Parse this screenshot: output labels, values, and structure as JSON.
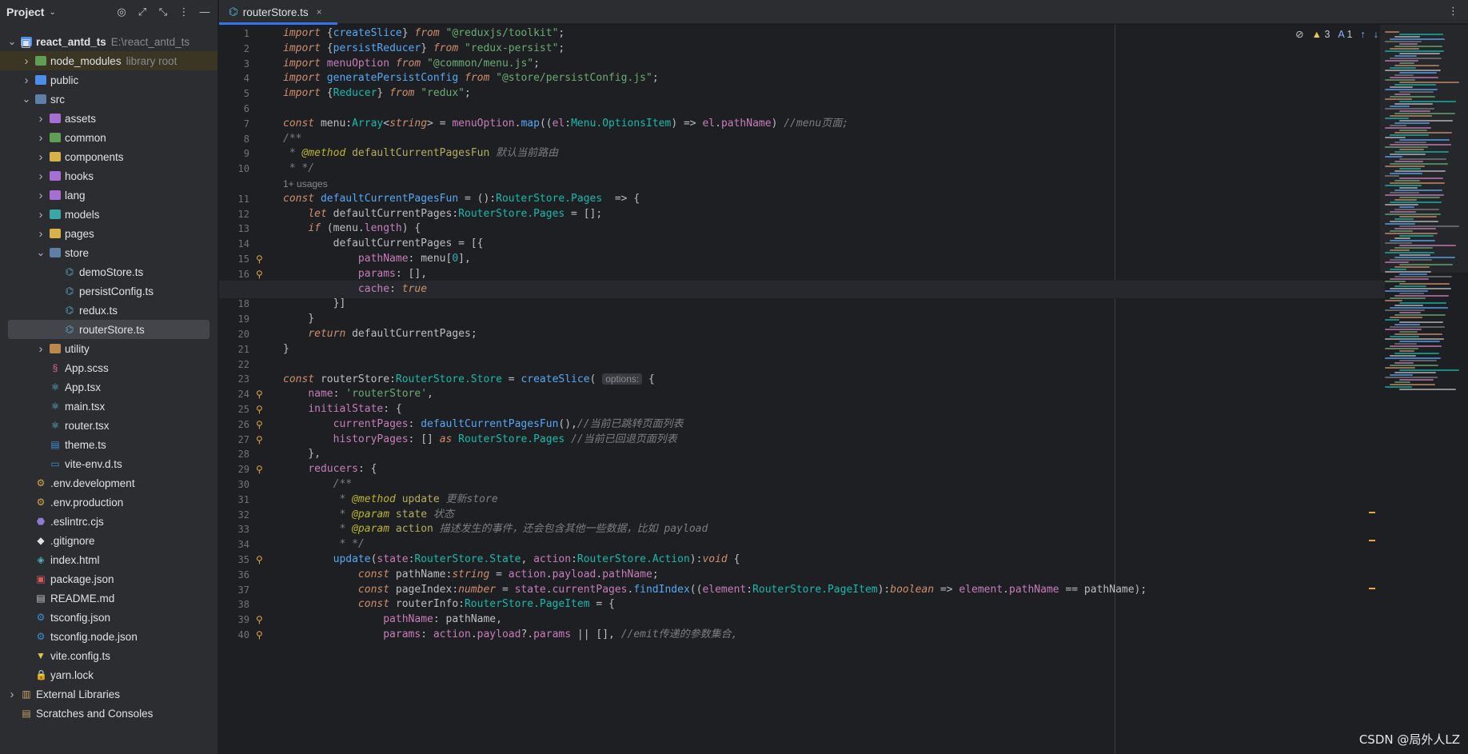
{
  "sidebar": {
    "title": "Project",
    "header_icons": [
      "target-icon",
      "expand-icon",
      "collapse-icon",
      "more-icon",
      "minimize-icon"
    ],
    "tree": [
      {
        "label": "react_antd_ts",
        "secondary": "E:\\react_antd_ts",
        "indent": 0,
        "arrow": "down",
        "icon": "folder-module",
        "bold": true
      },
      {
        "label": "node_modules",
        "secondary": "library root",
        "indent": 1,
        "arrow": "right",
        "icon": "folder-lib",
        "hl": "lib"
      },
      {
        "label": "public",
        "indent": 1,
        "arrow": "right",
        "icon": "folder-blue"
      },
      {
        "label": "src",
        "indent": 1,
        "arrow": "down",
        "icon": "folder-src"
      },
      {
        "label": "assets",
        "indent": 2,
        "arrow": "right",
        "icon": "folder-purple"
      },
      {
        "label": "common",
        "indent": 2,
        "arrow": "right",
        "icon": "folder-green"
      },
      {
        "label": "components",
        "indent": 2,
        "arrow": "right",
        "icon": "folder-yellow"
      },
      {
        "label": "hooks",
        "indent": 2,
        "arrow": "right",
        "icon": "folder-purple"
      },
      {
        "label": "lang",
        "indent": 2,
        "arrow": "right",
        "icon": "folder-purple"
      },
      {
        "label": "models",
        "indent": 2,
        "arrow": "right",
        "icon": "folder-teal"
      },
      {
        "label": "pages",
        "indent": 2,
        "arrow": "right",
        "icon": "folder-yellow"
      },
      {
        "label": "store",
        "indent": 2,
        "arrow": "down",
        "icon": "folder-modcol"
      },
      {
        "label": "demoStore.ts",
        "indent": 3,
        "icon": "ts-file"
      },
      {
        "label": "persistConfig.ts",
        "indent": 3,
        "icon": "ts-file"
      },
      {
        "label": "redux.ts",
        "indent": 3,
        "icon": "ts-file"
      },
      {
        "label": "routerStore.ts",
        "indent": 3,
        "icon": "ts-file",
        "hl": "sel"
      },
      {
        "label": "utility",
        "indent": 2,
        "arrow": "right",
        "icon": "folder"
      },
      {
        "label": "App.scss",
        "indent": 2,
        "icon": "scss-file"
      },
      {
        "label": "App.tsx",
        "indent": 2,
        "icon": "react-file"
      },
      {
        "label": "main.tsx",
        "indent": 2,
        "icon": "react-file"
      },
      {
        "label": "router.tsx",
        "indent": 2,
        "icon": "react-file"
      },
      {
        "label": "theme.ts",
        "indent": 2,
        "icon": "ts-blue-file"
      },
      {
        "label": "vite-env.d.ts",
        "indent": 2,
        "icon": "dts-file"
      },
      {
        "label": ".env.development",
        "indent": 1,
        "icon": "env-file"
      },
      {
        "label": ".env.production",
        "indent": 1,
        "icon": "env-file"
      },
      {
        "label": ".eslintrc.cjs",
        "indent": 1,
        "icon": "eslint-file"
      },
      {
        "label": ".gitignore",
        "indent": 1,
        "icon": "git-file"
      },
      {
        "label": "index.html",
        "indent": 1,
        "icon": "html-file"
      },
      {
        "label": "package.json",
        "indent": 1,
        "icon": "npm-file"
      },
      {
        "label": "README.md",
        "indent": 1,
        "icon": "md-file"
      },
      {
        "label": "tsconfig.json",
        "indent": 1,
        "icon": "tsconfig-file"
      },
      {
        "label": "tsconfig.node.json",
        "indent": 1,
        "icon": "tsconfig-file"
      },
      {
        "label": "vite.config.ts",
        "indent": 1,
        "icon": "vite-file"
      },
      {
        "label": "yarn.lock",
        "indent": 1,
        "icon": "lock-file"
      },
      {
        "label": "External Libraries",
        "indent": 0,
        "arrow": "right",
        "icon": "library"
      },
      {
        "label": "Scratches and Consoles",
        "indent": 0,
        "icon": "scratches"
      }
    ]
  },
  "tab": {
    "label": "routerStore.ts",
    "close": "×",
    "menu": "⋮"
  },
  "inspections": {
    "warnings": "3",
    "typos": "1"
  },
  "code_lines": [
    {
      "n": "1",
      "html": "<span class='kw'>import</span> {<span class='fn'>createSlice</span>} <span class='kw'>from</span> <span class='str'>\"@reduxjs/toolkit\"</span>;"
    },
    {
      "n": "2",
      "html": "<span class='kw'>import</span> {<span class='fn'>persistReducer</span>} <span class='kw'>from</span> <span class='str'>\"redux-persist\"</span>;"
    },
    {
      "n": "3",
      "html": "<span class='kw'>import</span> <span class='im'>menuOption</span> <span class='kw'>from</span> <span class='str'>\"@common/menu.js\"</span>;"
    },
    {
      "n": "4",
      "html": "<span class='kw'>import</span> <span class='fn'>generatePersistConfig</span> <span class='kw'>from</span> <span class='str'>\"@store/persistConfig.js\"</span>;"
    },
    {
      "n": "5",
      "html": "<span class='kw'>import</span> {<span class='ty'>Reducer</span>} <span class='kw'>from</span> <span class='str'>\"redux\"</span>;"
    },
    {
      "n": "6",
      "html": ""
    },
    {
      "n": "7",
      "html": "<span class='kw'>const</span> menu:<span class='ty'>Array</span>&lt;<span class='tp'>string</span>&gt; = <span class='im'>menuOption</span>.<span class='fn'>map</span>((<span class='prop'>el</span>:<span class='ty'>Menu.OptionsItem</span>) =&gt; <span class='prop'>el</span>.<span class='prop'>pathName</span>) <span class='cm'>//menu页面;</span>"
    },
    {
      "n": "8",
      "html": "<span class='cm'>/**</span>"
    },
    {
      "n": "9",
      "html": "<span class='cm'> * </span><span class='tg'>@method</span><span class='cm'> </span><span class='ann'>defaultCurrentPagesFun</span><span class='cm'> 默认当前路由</span>"
    },
    {
      "n": "10",
      "html": "<span class='cm'> * */</span>"
    },
    {
      "n": "",
      "html": "<span class='hint'>1+ usages</span>"
    },
    {
      "n": "11",
      "html": "<span class='kw'>const</span> <span class='fn'>defaultCurrentPagesFun</span> = ():<span class='ty'>RouterStore.Pages</span>  =&gt; {"
    },
    {
      "n": "12",
      "html": "    <span class='kw'>let</span> defaultCurrentPages:<span class='ty'>RouterStore.Pages</span> = [];"
    },
    {
      "n": "13",
      "html": "    <span class='kw'>if</span> (menu.<span class='prop'>length</span>) {"
    },
    {
      "n": "14",
      "html": "        defaultCurrentPages = [{"
    },
    {
      "n": "15",
      "html": "            <span class='prop'>pathName</span>: menu[<span class='num'>0</span>],",
      "g": true
    },
    {
      "n": "16",
      "html": "            <span class='prop'>params</span>: [],",
      "g": true
    },
    {
      "n": "17",
      "html": "            <span class='prop'>cache</span>: <span class='kw'>true</span>",
      "g": true,
      "cur": true
    },
    {
      "n": "18",
      "html": "        }]"
    },
    {
      "n": "19",
      "html": "    }"
    },
    {
      "n": "20",
      "html": "    <span class='kw'>return</span> defaultCurrentPages;"
    },
    {
      "n": "21",
      "html": "}"
    },
    {
      "n": "22",
      "html": ""
    },
    {
      "n": "23",
      "html": "<span class='kw'>const</span> routerStore:<span class='ty'>RouterStore.Store</span> = <span class='fn'>createSlice</span>( <span class='inlay'>options:</span> {"
    },
    {
      "n": "24",
      "html": "    <span class='prop'>name</span>: <span class='str'>'routerStore'</span>,",
      "g": true
    },
    {
      "n": "25",
      "html": "    <span class='prop'>initialState</span>: {",
      "g": true
    },
    {
      "n": "26",
      "html": "        <span class='prop'>currentPages</span>: <span class='fn'>defaultCurrentPagesFun</span>(),<span class='cm'>//当前已跳转页面列表</span>",
      "g": true
    },
    {
      "n": "27",
      "html": "        <span class='prop'>historyPages</span>: [] <span class='kw'>as</span> <span class='ty'>RouterStore.Pages</span> <span class='cm'>//当前已回退页面列表</span>",
      "g": true
    },
    {
      "n": "28",
      "html": "    },"
    },
    {
      "n": "29",
      "html": "    <span class='prop'>reducers</span>: {",
      "g": true
    },
    {
      "n": "30",
      "html": "        <span class='cm'>/**</span>"
    },
    {
      "n": "31",
      "html": "<span class='cm'>         * </span><span class='tg'>@method</span><span class='cm'> </span><span class='ann'>update</span><span class='cm'> 更新store</span>"
    },
    {
      "n": "32",
      "html": "<span class='cm'>         * </span><span class='tg'>@param</span><span class='cm'> </span><span class='ann'>state</span><span class='cm'> 状态</span>"
    },
    {
      "n": "33",
      "html": "<span class='cm'>         * </span><span class='tg'>@param</span><span class='cm'> </span><span class='ann'>action</span><span class='cm'> 描述发生的事件，还会包含其他一些数据，比如 payload</span>"
    },
    {
      "n": "34",
      "html": "<span class='cm'>         * */</span>"
    },
    {
      "n": "35",
      "html": "        <span class='fn'>update</span>(<span class='prop'>state</span>:<span class='ty'>RouterStore.State</span>, <span class='prop'>action</span>:<span class='ty'>RouterStore.Action</span>):<span class='kw'>void</span> {",
      "g": true
    },
    {
      "n": "36",
      "html": "            <span class='kw'>const</span> pathName:<span class='tp'>string</span> = <span class='prop'>action</span>.<span class='prop'>payload</span>.<span class='prop'>pathName</span>;"
    },
    {
      "n": "37",
      "html": "            <span class='kw'>const</span> pageIndex:<span class='tp'>number</span> = <span class='prop'>state</span>.<span class='prop'>currentPages</span>.<span class='fn'>findIndex</span>((<span class='prop'>element</span>:<span class='ty'>RouterStore.PageItem</span>):<span class='tp'>boolean</span> =&gt; <span class='prop'>element</span>.<span class='prop'>pathName</span> == pathName);"
    },
    {
      "n": "38",
      "html": "            <span class='kw'>const</span> routerInfo:<span class='ty'>RouterStore.PageItem</span> = {"
    },
    {
      "n": "39",
      "html": "                <span class='prop'>pathName</span>: pathName,",
      "g": true
    },
    {
      "n": "40",
      "html": "                <span class='prop'>params</span>: <span class='prop'>action</span>.<span class='prop'>payload</span>?.<span class='prop'>params</span> || [], <span class='cm'>//emit传递的参数集合,</span>",
      "g": true
    }
  ],
  "watermark": "CSDN @局外人LZ",
  "colors": {
    "accent": "#3574f0",
    "sidebar_bg": "#2b2d30",
    "editor_bg": "#1e1f22"
  }
}
